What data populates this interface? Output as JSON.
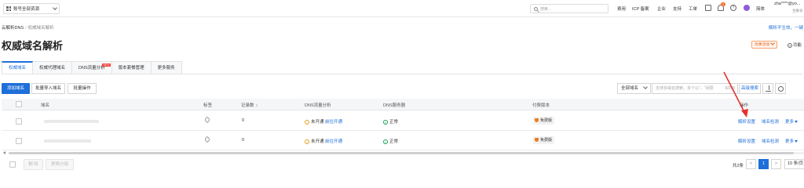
{
  "topbar": {
    "resource_switch": "账号全部资源",
    "search_placeholder": "搜索...",
    "nav": [
      "费用",
      "ICP 备案",
      "企业",
      "支持",
      "工单"
    ],
    "notification_count": "2",
    "lang": "简体",
    "user_name": "zha****@yo...",
    "user_sub": "主账号"
  },
  "breadcrumb": {
    "root": "云解析DNS",
    "sep": "/",
    "current": "权威域名解析"
  },
  "help_link": "解析不生效，一键",
  "page_title": "权威域名解析",
  "promo_button": "优惠活动",
  "func_link": "功能",
  "tabs": [
    {
      "label": "权威域名",
      "active": true
    },
    {
      "label": "权威代理域名",
      "active": false
    },
    {
      "label": "DNS流量分析",
      "active": false,
      "badge": "NEW"
    },
    {
      "label": "版本套餐管理",
      "active": false
    },
    {
      "label": "更多服务",
      "active": false
    }
  ],
  "toolbar": {
    "add_domain": "添加域名",
    "batch_import": "批量导入域名",
    "batch_ops": "批量操作",
    "filter_select": "全部域名",
    "search_placeholder": "支持多域名搜索，多个以\"，\"间隔",
    "search_count": "0/255",
    "advanced_search": "高级搜索"
  },
  "table": {
    "headers": {
      "domain": "域名",
      "tag": "标签",
      "record_count": "记录数",
      "dns_traffic": "DNS流量分析",
      "dns_server": "DNS服务器",
      "version": "付费版本",
      "ops": "操作"
    },
    "rows": [
      {
        "record_count": "0",
        "traffic_status": "未开通",
        "traffic_link": "前往开通",
        "dns_status": "正常",
        "version": "免费版",
        "op_resolve": "解析设置",
        "op_check": "域名检测",
        "op_more": "更多"
      },
      {
        "record_count": "0",
        "traffic_status": "未开通",
        "traffic_link": "前往开通",
        "dns_status": "正常",
        "version": "免费版",
        "op_resolve": "解析设置",
        "op_check": "域名检测",
        "op_more": "更多"
      }
    ]
  },
  "footer": {
    "delete": "删 除",
    "change_group": "更换分组",
    "total": "共2条",
    "prev": "<",
    "current_page": "1",
    "next": ">",
    "page_size": "10 条/页"
  },
  "colors": {
    "primary": "#1e6fd9",
    "warning": "#e3a01c",
    "success": "#1ea25a",
    "annotation": "#e5322d"
  }
}
